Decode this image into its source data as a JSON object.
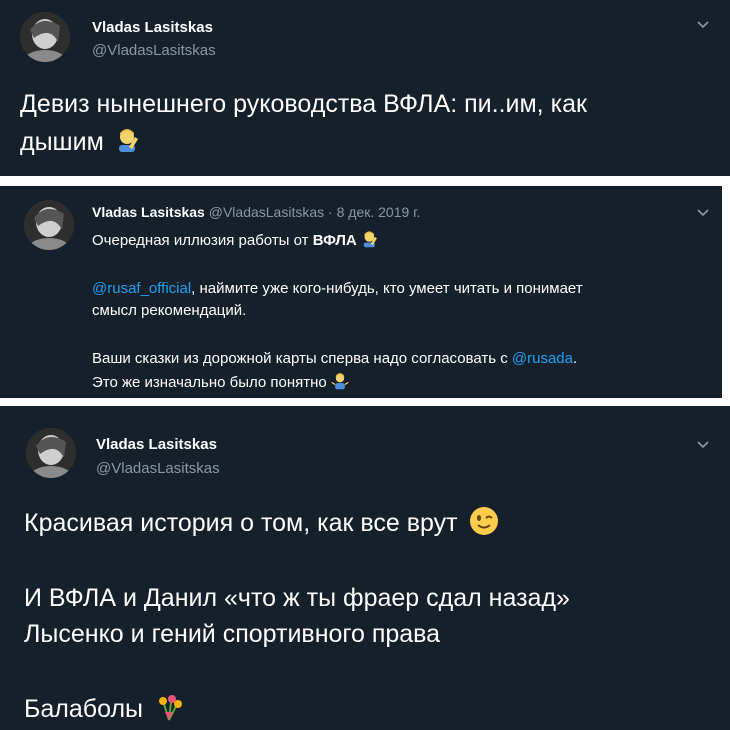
{
  "tweet1": {
    "author_name": "Vladas Lasitskas",
    "author_handle": "@VladasLasitskas",
    "text_line1": "Девиз нынешнего руководства ВФЛА: пи..им, как",
    "text_line2": "дышим",
    "emoji": "facepalm-emoji"
  },
  "tweet2": {
    "author_name": "Vladas Lasitskas",
    "author_handle": "@VladasLasitskas",
    "dot": "·",
    "date": "8 дек. 2019 г.",
    "line1_text": "Очередная иллюзия работы от",
    "line1_bold": "ВФЛА",
    "mention1": "@rusaf_official",
    "line2_rest": ", наймите уже кого-нибудь, кто умеет читать и понимает",
    "line3": "смысл рекомендаций.",
    "line4_text": "Ваши сказки из дорожной карты сперва надо согласовать с",
    "mention2": "@rusada",
    "line4_end": ".",
    "line5": "Это же изначально было понятно",
    "emoji1": "facepalm-emoji",
    "emoji2": "shrug-emoji"
  },
  "tweet3": {
    "author_name": "Vladas Lasitskas",
    "author_handle": "@VladasLasitskas",
    "line1": "Красивая история о том, как все врут",
    "line2": "И ВФЛА и Данил «что ж ты фраер сдал назад»",
    "line3": "Лысенко и гений спортивного права",
    "line4": "Балаболы",
    "emoji1": "winking-face-emoji",
    "emoji2": "bouquet-emoji"
  },
  "colors": {
    "background": "#15202b",
    "text": "#ffffff",
    "secondary": "#8899a6",
    "link": "#1da1f2"
  }
}
